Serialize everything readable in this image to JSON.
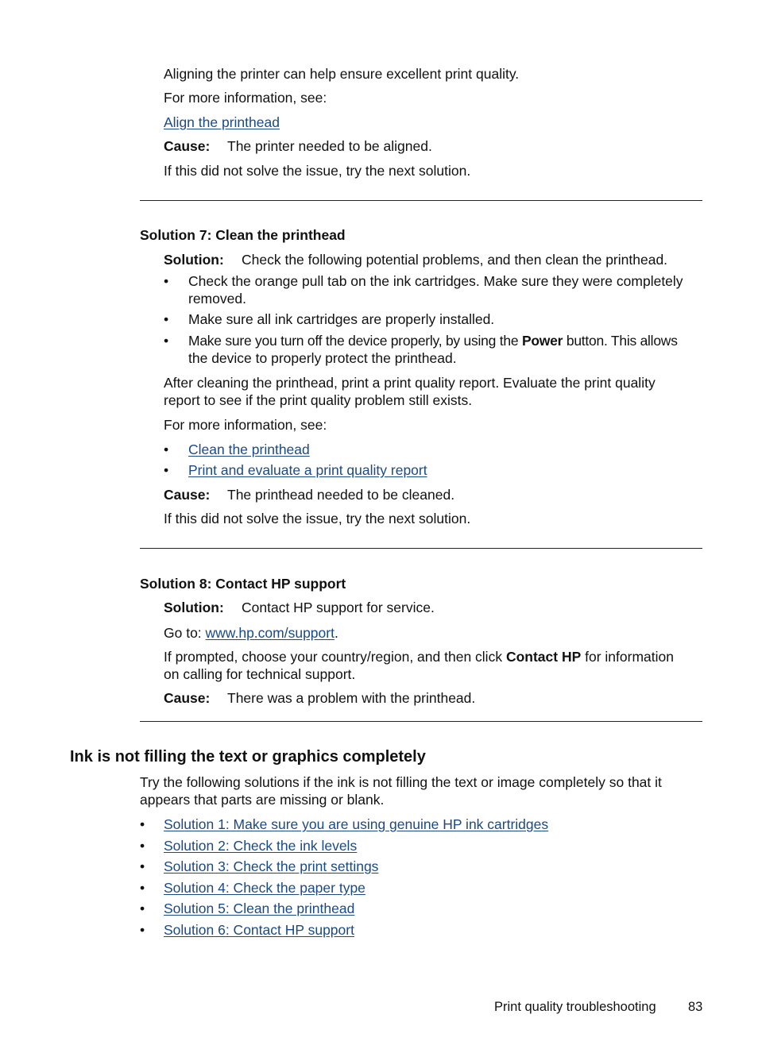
{
  "top_section": {
    "para1": "Aligning the printer can help ensure excellent print quality.",
    "more_info": "For more information, see:",
    "link_align": "Align the printhead",
    "cause_label": "Cause:",
    "cause_text": "The printer needed to be aligned.",
    "next": "If this did not solve the issue, try the next solution."
  },
  "solution7": {
    "heading": "Solution 7: Clean the printhead",
    "solution_label": "Solution:",
    "solution_text": "Check the following potential problems, and then clean the printhead.",
    "bullets": [
      {
        "line1": "Check the orange pull tab on the ink cartridges. Make sure they were completely",
        "line2": "removed."
      },
      {
        "line1": "Make sure all ink cartridges are properly installed."
      },
      {
        "pre": "Make sure you turn off the device properly, by using the ",
        "bold": "Power",
        "post": " button. This allows",
        "line2": "the device to properly protect the printhead."
      }
    ],
    "after_line1": "After cleaning the printhead, print a print quality report. Evaluate the print quality",
    "after_line2": "report to see if the print quality problem still exists.",
    "more_info": "For more information, see:",
    "links": [
      "Clean the printhead",
      "Print and evaluate a print quality report"
    ],
    "cause_label": "Cause:",
    "cause_text": "The printhead needed to be cleaned.",
    "next": "If this did not solve the issue, try the next solution."
  },
  "solution8": {
    "heading": "Solution 8: Contact HP support",
    "solution_label": "Solution:",
    "solution_text": "Contact HP support for service.",
    "goto_pre": "Go to: ",
    "goto_link": "www.hp.com/support",
    "goto_post": ".",
    "prompt_pre": "If prompted, choose your country/region, and then click ",
    "prompt_bold": "Contact HP",
    "prompt_post": " for information",
    "prompt_line2": "on calling for technical support.",
    "cause_label": "Cause:",
    "cause_text": "There was a problem with the printhead."
  },
  "ink_section": {
    "heading": "Ink is not filling the text or graphics completely",
    "intro_line1": "Try the following solutions if the ink is not filling the text or image completely so that it",
    "intro_line2": "appears that parts are missing or blank.",
    "links": [
      "Solution 1: Make sure you are using genuine HP ink cartridges",
      "Solution 2: Check the ink levels",
      "Solution 3: Check the print settings",
      "Solution 4: Check the paper type",
      "Solution 5: Clean the printhead",
      "Solution 6: Contact HP support"
    ]
  },
  "footer": {
    "section": "Print quality troubleshooting",
    "page_number": "83"
  },
  "bullet_char": "•"
}
